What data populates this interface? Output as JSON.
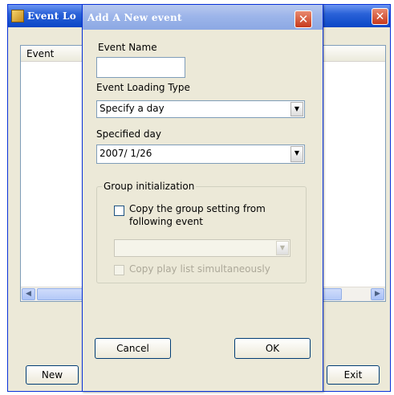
{
  "background_window": {
    "title": "Event Lo",
    "close_glyph": "✕",
    "list_header": "Event",
    "scroll_left": "◀",
    "scroll_right": "▶",
    "new_label": "New",
    "exit_label": "Exit"
  },
  "dialog": {
    "title": "Add A New event",
    "close_glyph": "✕",
    "event_name_label": "Event Name",
    "event_name_value": "",
    "loading_type_label": "Event Loading Type",
    "loading_type_value": "Specify a day",
    "specified_day_label": "Specified day",
    "specified_day_value": "2007/  1/26",
    "group": {
      "legend": "Group initialization",
      "copy_group_label_line1": "Copy the group setting from",
      "copy_group_label_line2": "following event",
      "copy_group_checked": false,
      "event_select_value": "",
      "copy_playlist_label": "Copy play list simultaneously",
      "copy_playlist_checked": false
    },
    "cancel_label": "Cancel",
    "ok_label": "OK"
  },
  "icons": {
    "combo_arrow": "▼"
  }
}
